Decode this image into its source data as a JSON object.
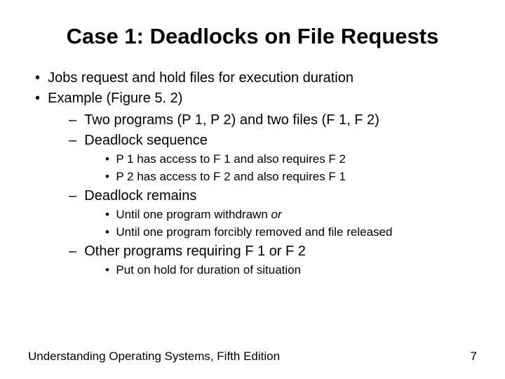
{
  "title": "Case 1: Deadlocks on File Requests",
  "bullets": {
    "b1": "Jobs request and hold files for execution duration",
    "b2": "Example (Figure 5. 2)",
    "s1": "Two programs (P 1, P 2) and two files (F 1, F 2)",
    "s2": "Deadlock sequence",
    "s2a": "P 1 has access to F 1 and also requires F 2",
    "s2b": "P 2 has access to F 2 and also requires F 1",
    "s3": "Deadlock remains",
    "s3a_pre": "Until one program withdrawn ",
    "s3a_it": "or",
    "s3b": "Until one program forcibly removed and file released",
    "s4": "Other programs requiring F 1 or F 2",
    "s4a": "Put on hold for duration of situation"
  },
  "footer": {
    "left": "Understanding Operating Systems, Fifth Edition",
    "right": "7"
  }
}
